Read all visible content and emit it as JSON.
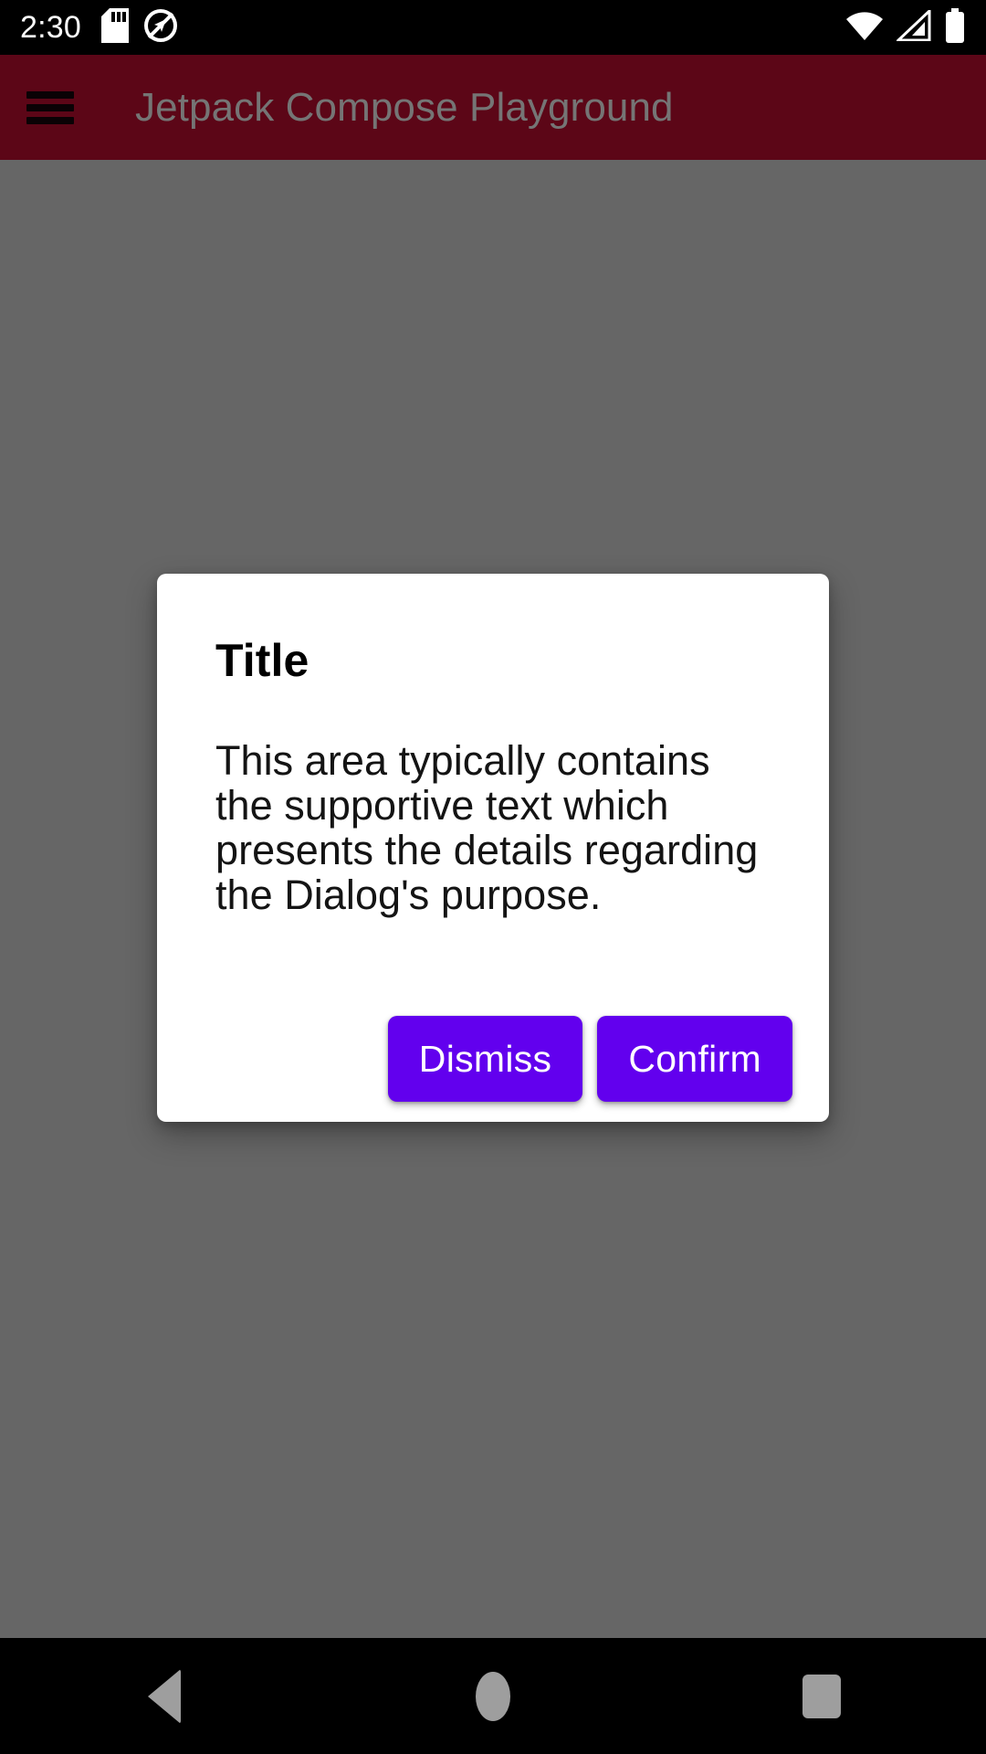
{
  "status_bar": {
    "clock": "2:30",
    "left_icons": [
      {
        "name": "sd-card-icon",
        "label": "SD card"
      },
      {
        "name": "location-off-icon",
        "label": "Location off"
      }
    ],
    "right_icons": [
      {
        "name": "wifi-icon",
        "label": "Wi-Fi full signal"
      },
      {
        "name": "cellular-signal-icon",
        "label": "Cellular signal"
      },
      {
        "name": "battery-full-icon",
        "label": "Battery full"
      }
    ],
    "background_color": "#000000",
    "foreground_color": "#ffffff"
  },
  "app_bar": {
    "title": "Jetpack Compose Playground",
    "menu_icon": "hamburger-menu-icon",
    "background_color": "#5c0617",
    "title_color": "#757575"
  },
  "scrim": {
    "color": "#666666"
  },
  "dialog": {
    "title": "Title",
    "body": "This area typically contains the supportive text which presents the details regarding the Dialog's purpose.",
    "dismiss_label": "Dismiss",
    "confirm_label": "Confirm",
    "surface_color": "#ffffff",
    "button_color": "#6200ee",
    "button_text_color": "#ffffff",
    "title_color": "#000000"
  },
  "nav_bar": {
    "background_color": "#000000",
    "icon_color": "#9e9e9e",
    "buttons": [
      {
        "name": "nav-back-button",
        "label": "Back"
      },
      {
        "name": "nav-home-button",
        "label": "Home"
      },
      {
        "name": "nav-recents-button",
        "label": "Recent apps"
      }
    ]
  }
}
